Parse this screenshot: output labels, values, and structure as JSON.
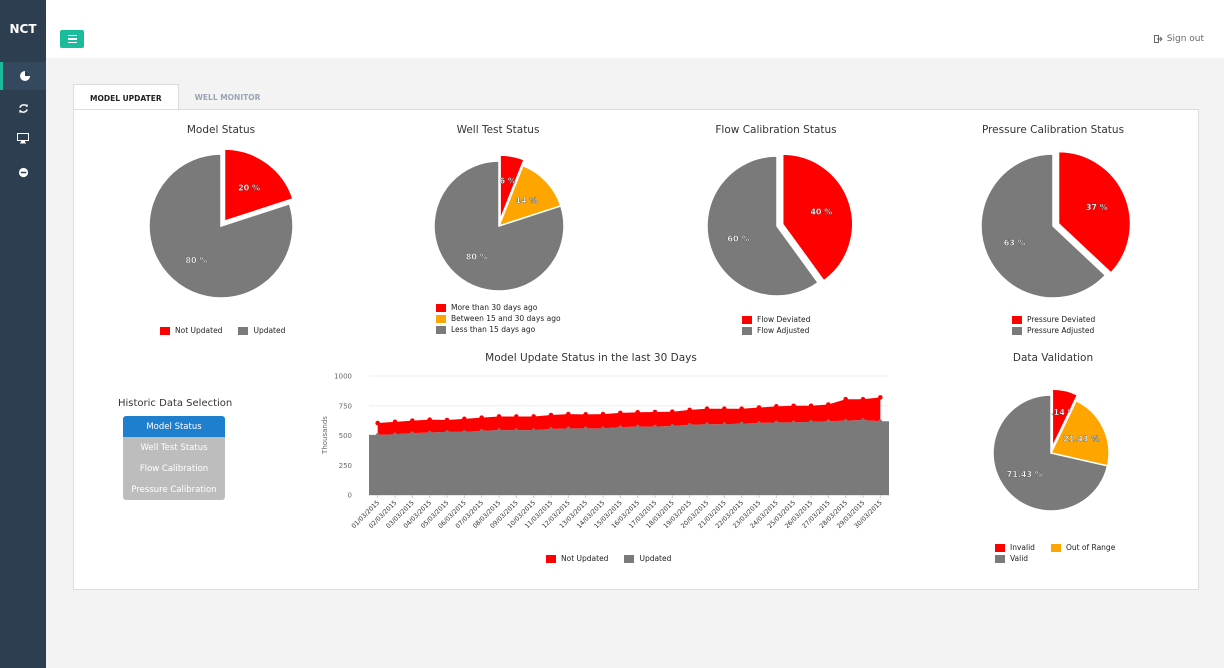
{
  "brand": "NCT",
  "topbar": {
    "signout_label": "Sign out"
  },
  "sidebar_icons": [
    "dashboard-icon",
    "refresh-icon",
    "monitor-icon",
    "minus-circle-icon"
  ],
  "tabs": [
    {
      "label": "MODEL UPDATER"
    },
    {
      "label": "WELL MONITOR"
    }
  ],
  "colors": {
    "red": "#ff0000",
    "gray": "#7a7a7a",
    "orange": "#ffa500",
    "teal": "#1abc9c",
    "blue": "#1e7fcf"
  },
  "pies": [
    {
      "title": "Model Status",
      "slices": [
        {
          "label": "Not Updated",
          "value": 20,
          "text": "20 %",
          "color": "#ff0000"
        },
        {
          "label": "Updated",
          "value": 80,
          "text": "80 %",
          "color": "#7a7a7a"
        }
      ]
    },
    {
      "title": "Well Test Status",
      "slices": [
        {
          "label": "More than 30 days ago",
          "value": 6,
          "text": "6 %",
          "color": "#ff0000"
        },
        {
          "label": "Between 15 and 30 days ago",
          "value": 14,
          "text": "14 %",
          "color": "#ffa500"
        },
        {
          "label": "Less than 15 days ago",
          "value": 80,
          "text": "80 %",
          "color": "#7a7a7a"
        }
      ]
    },
    {
      "title": "Flow Calibration Status",
      "slices": [
        {
          "label": "Flow Deviated",
          "value": 40,
          "text": "40 %",
          "color": "#ff0000"
        },
        {
          "label": "Flow Adjusted",
          "value": 60,
          "text": "60 %",
          "color": "#7a7a7a"
        }
      ]
    },
    {
      "title": "Pressure Calibration Status",
      "slices": [
        {
          "label": "Pressure Deviated",
          "value": 37,
          "text": "37 %",
          "color": "#ff0000"
        },
        {
          "label": "Pressure Adjusted",
          "value": 63,
          "text": "63 %",
          "color": "#7a7a7a"
        }
      ]
    },
    {
      "title": "Data Validation",
      "slices": [
        {
          "label": "Invalid",
          "value": 7.14,
          "text": "7.14 %",
          "color": "#ff0000"
        },
        {
          "label": "Out of Range",
          "value": 21.43,
          "text": "21.43 %",
          "color": "#ffa500"
        },
        {
          "label": "Valid",
          "value": 71.43,
          "text": "71.43 %",
          "color": "#7a7a7a"
        }
      ]
    }
  ],
  "historic": {
    "title": "Historic Data Selection",
    "buttons": [
      "Model Status",
      "Well Test Status",
      "Flow Calibration",
      "Pressure Calibration"
    ]
  },
  "chart_data": {
    "type": "area",
    "title": "Model Update Status in the last 30 Days",
    "ylabel": "Thousands",
    "ylim": [
      0,
      1000
    ],
    "yticks": [
      "0",
      "250",
      "500",
      "750",
      "1000"
    ],
    "categories": [
      "01/03/2015",
      "02/03/2015",
      "03/03/2015",
      "04/03/2015",
      "05/03/2015",
      "06/03/2015",
      "07/03/2015",
      "08/03/2015",
      "09/03/2015",
      "10/03/2015",
      "11/03/2015",
      "12/03/2015",
      "13/03/2015",
      "14/03/2015",
      "15/03/2015",
      "16/03/2015",
      "17/03/2015",
      "18/03/2015",
      "19/03/2015",
      "20/03/2015",
      "21/03/2015",
      "22/03/2015",
      "23/03/2015",
      "24/03/2015",
      "25/03/2015",
      "26/03/2015",
      "27/03/2015",
      "28/03/2015",
      "29/03/2015",
      "30/03/2015"
    ],
    "series": [
      {
        "name": "Updated",
        "color": "#7a7a7a",
        "values": [
          505,
          510,
          520,
          525,
          530,
          530,
          540,
          545,
          545,
          545,
          555,
          560,
          560,
          560,
          570,
          575,
          575,
          580,
          590,
          595,
          595,
          600,
          605,
          610,
          610,
          615,
          620,
          625,
          630,
          620
        ]
      },
      {
        "name": "Not Updated",
        "color": "#ff0000",
        "values": [
          100,
          105,
          105,
          108,
          100,
          110,
          110,
          115,
          115,
          115,
          117,
          120,
          118,
          120,
          120,
          120,
          122,
          120,
          125,
          130,
          130,
          125,
          130,
          135,
          140,
          135,
          140,
          180,
          175,
          200
        ]
      }
    ]
  }
}
